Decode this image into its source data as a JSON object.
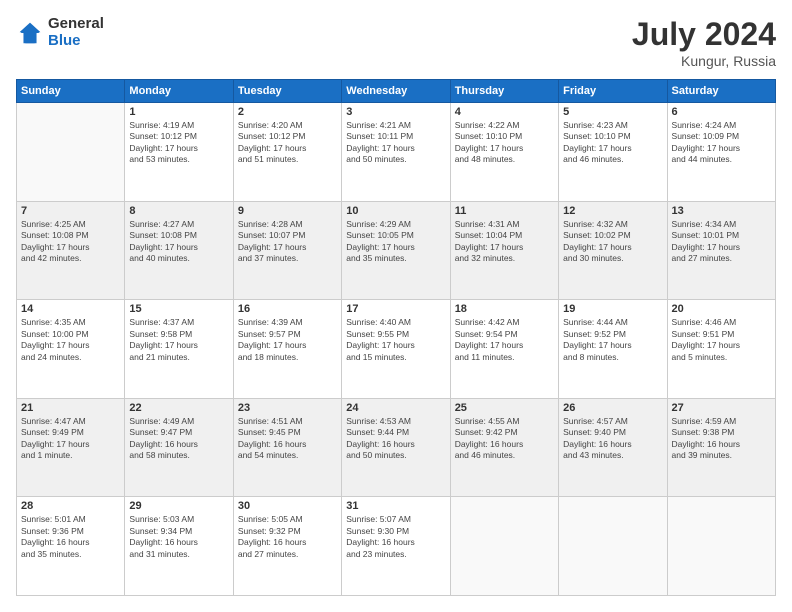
{
  "logo": {
    "general": "General",
    "blue": "Blue"
  },
  "header": {
    "month_year": "July 2024",
    "location": "Kungur, Russia"
  },
  "weekdays": [
    "Sunday",
    "Monday",
    "Tuesday",
    "Wednesday",
    "Thursday",
    "Friday",
    "Saturday"
  ],
  "weeks": [
    [
      {
        "day": "",
        "info": ""
      },
      {
        "day": "1",
        "info": "Sunrise: 4:19 AM\nSunset: 10:12 PM\nDaylight: 17 hours\nand 53 minutes."
      },
      {
        "day": "2",
        "info": "Sunrise: 4:20 AM\nSunset: 10:12 PM\nDaylight: 17 hours\nand 51 minutes."
      },
      {
        "day": "3",
        "info": "Sunrise: 4:21 AM\nSunset: 10:11 PM\nDaylight: 17 hours\nand 50 minutes."
      },
      {
        "day": "4",
        "info": "Sunrise: 4:22 AM\nSunset: 10:10 PM\nDaylight: 17 hours\nand 48 minutes."
      },
      {
        "day": "5",
        "info": "Sunrise: 4:23 AM\nSunset: 10:10 PM\nDaylight: 17 hours\nand 46 minutes."
      },
      {
        "day": "6",
        "info": "Sunrise: 4:24 AM\nSunset: 10:09 PM\nDaylight: 17 hours\nand 44 minutes."
      }
    ],
    [
      {
        "day": "7",
        "info": ""
      },
      {
        "day": "8",
        "info": "Sunrise: 4:27 AM\nSunset: 10:08 PM\nDaylight: 17 hours\nand 40 minutes."
      },
      {
        "day": "9",
        "info": "Sunrise: 4:28 AM\nSunset: 10:07 PM\nDaylight: 17 hours\nand 37 minutes."
      },
      {
        "day": "10",
        "info": "Sunrise: 4:29 AM\nSunset: 10:05 PM\nDaylight: 17 hours\nand 35 minutes."
      },
      {
        "day": "11",
        "info": "Sunrise: 4:31 AM\nSunset: 10:04 PM\nDaylight: 17 hours\nand 32 minutes."
      },
      {
        "day": "12",
        "info": "Sunrise: 4:32 AM\nSunset: 10:02 PM\nDaylight: 17 hours\nand 30 minutes."
      },
      {
        "day": "13",
        "info": "Sunrise: 4:34 AM\nSunset: 10:01 PM\nDaylight: 17 hours\nand 27 minutes."
      }
    ],
    [
      {
        "day": "14",
        "info": ""
      },
      {
        "day": "15",
        "info": "Sunrise: 4:37 AM\nSunset: 9:58 PM\nDaylight: 17 hours\nand 21 minutes."
      },
      {
        "day": "16",
        "info": "Sunrise: 4:39 AM\nSunset: 9:57 PM\nDaylight: 17 hours\nand 18 minutes."
      },
      {
        "day": "17",
        "info": "Sunrise: 4:40 AM\nSunset: 9:55 PM\nDaylight: 17 hours\nand 15 minutes."
      },
      {
        "day": "18",
        "info": "Sunrise: 4:42 AM\nSunset: 9:54 PM\nDaylight: 17 hours\nand 11 minutes."
      },
      {
        "day": "19",
        "info": "Sunrise: 4:44 AM\nSunset: 9:52 PM\nDaylight: 17 hours\nand 8 minutes."
      },
      {
        "day": "20",
        "info": "Sunrise: 4:46 AM\nSunset: 9:51 PM\nDaylight: 17 hours\nand 5 minutes."
      }
    ],
    [
      {
        "day": "21",
        "info": ""
      },
      {
        "day": "22",
        "info": "Sunrise: 4:49 AM\nSunset: 9:47 PM\nDaylight: 16 hours\nand 58 minutes."
      },
      {
        "day": "23",
        "info": "Sunrise: 4:51 AM\nSunset: 9:45 PM\nDaylight: 16 hours\nand 54 minutes."
      },
      {
        "day": "24",
        "info": "Sunrise: 4:53 AM\nSunset: 9:44 PM\nDaylight: 16 hours\nand 50 minutes."
      },
      {
        "day": "25",
        "info": "Sunrise: 4:55 AM\nSunset: 9:42 PM\nDaylight: 16 hours\nand 46 minutes."
      },
      {
        "day": "26",
        "info": "Sunrise: 4:57 AM\nSunset: 9:40 PM\nDaylight: 16 hours\nand 43 minutes."
      },
      {
        "day": "27",
        "info": "Sunrise: 4:59 AM\nSunset: 9:38 PM\nDaylight: 16 hours\nand 39 minutes."
      }
    ],
    [
      {
        "day": "28",
        "info": "Sunrise: 5:01 AM\nSunset: 9:36 PM\nDaylight: 16 hours\nand 35 minutes."
      },
      {
        "day": "29",
        "info": "Sunrise: 5:03 AM\nSunset: 9:34 PM\nDaylight: 16 hours\nand 31 minutes."
      },
      {
        "day": "30",
        "info": "Sunrise: 5:05 AM\nSunset: 9:32 PM\nDaylight: 16 hours\nand 27 minutes."
      },
      {
        "day": "31",
        "info": "Sunrise: 5:07 AM\nSunset: 9:30 PM\nDaylight: 16 hours\nand 23 minutes."
      },
      {
        "day": "",
        "info": ""
      },
      {
        "day": "",
        "info": ""
      },
      {
        "day": "",
        "info": ""
      }
    ]
  ],
  "week1_sunday": {
    "day": "7",
    "info": "Sunrise: 4:25 AM\nSunset: 10:08 PM\nDaylight: 17 hours\nand 42 minutes."
  },
  "week3_sunday": {
    "day": "14",
    "info": "Sunrise: 4:35 AM\nSunset: 10:00 PM\nDaylight: 17 hours\nand 24 minutes."
  },
  "week4_sunday": {
    "day": "21",
    "info": "Sunrise: 4:47 AM\nSunset: 9:49 PM\nDaylight: 17 hours\nand 1 minute."
  }
}
